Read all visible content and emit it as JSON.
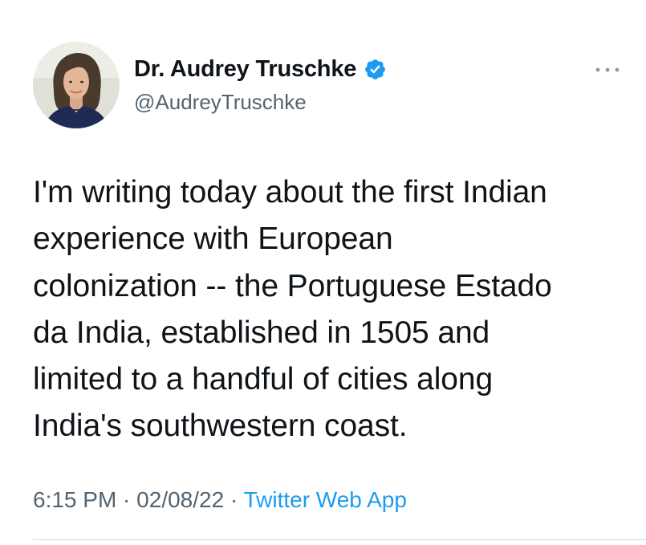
{
  "author": {
    "display_name": "Dr. Audrey Truschke",
    "handle": "@AudreyTruschke",
    "verified": true,
    "verified_icon": "verified-badge-icon",
    "avatar": "profile-photo"
  },
  "menu": {
    "icon": "more-horizontal-icon"
  },
  "tweet": {
    "lines": [
      "I'm writing today about the first Indian",
      "experience with European",
      "colonization -- the Portuguese Estado",
      "da India, established in 1505 and",
      "limited to a handful of cities along",
      "India's southwestern coast."
    ]
  },
  "meta": {
    "time": "6:15 PM",
    "separator": " · ",
    "date": "02/08/22",
    "source": "Twitter Web App"
  },
  "colors": {
    "text": "#0f1419",
    "secondary": "#536471",
    "accent": "#1d9bf0",
    "divider": "#cfd9de"
  }
}
